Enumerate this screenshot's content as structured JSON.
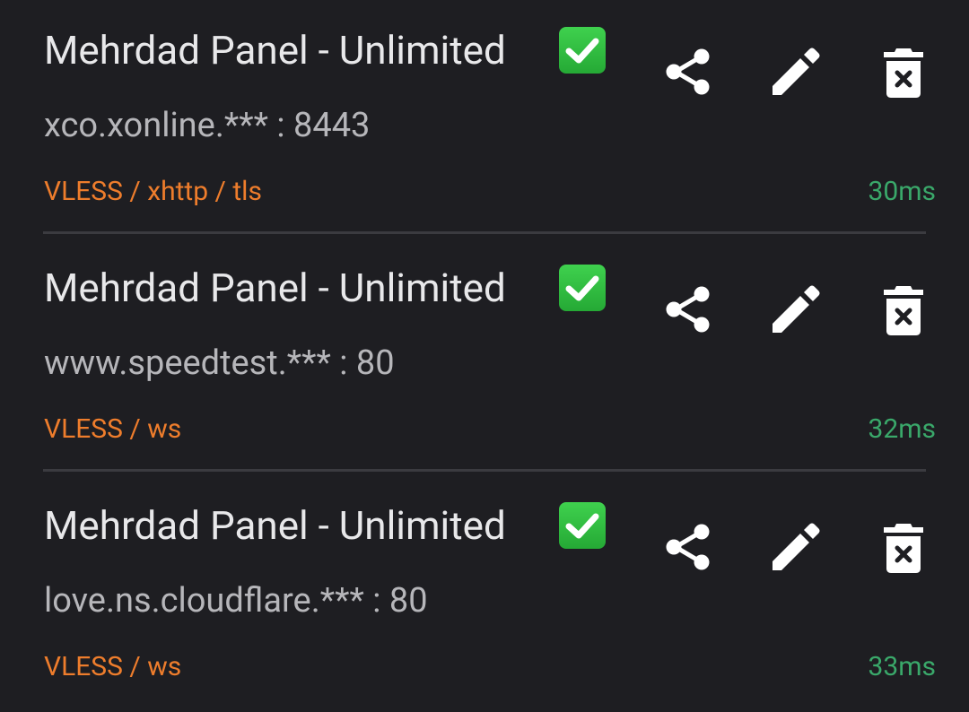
{
  "servers": [
    {
      "title": "Mehrdad Panel - Unlimited",
      "address": "xco.xonline.*** : 8443",
      "protocol": "VLESS / xhttp / tls",
      "latency": "30ms"
    },
    {
      "title": "Mehrdad Panel - Unlimited",
      "address": "www.speedtest.*** : 80",
      "protocol": "VLESS / ws",
      "latency": "32ms"
    },
    {
      "title": "Mehrdad Panel - Unlimited",
      "address": "love.ns.cloudflare.*** : 80",
      "protocol": "VLESS / ws",
      "latency": "33ms"
    }
  ],
  "icons": {
    "status": "check-mark-button-icon",
    "share": "share-icon",
    "edit": "pencil-icon",
    "delete": "delete-icon"
  },
  "colors": {
    "background": "#1e1e22",
    "title": "#e8e8ea",
    "address": "#b6b6ba",
    "protocol": "#ee7d2c",
    "latency": "#3aa86a",
    "check_emoji": "#2ebc3f",
    "divider": "#3b3b40"
  }
}
